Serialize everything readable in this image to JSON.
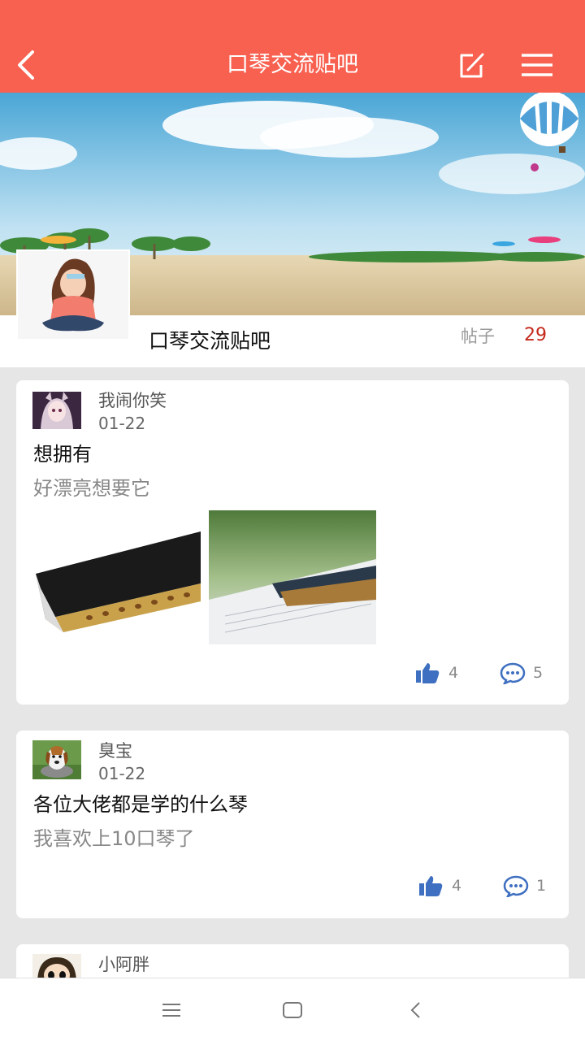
{
  "header": {
    "title": "口琴交流贴吧",
    "back_icon": "back-arrow-icon",
    "edit_icon": "edit-icon",
    "menu_icon": "menu-icon",
    "bg_color": "#f8604f"
  },
  "forum": {
    "name": "口琴交流贴吧",
    "posts_label": "帖子",
    "posts_count": "29"
  },
  "posts": [
    {
      "author": "我闹你笑",
      "date": "01-22",
      "title": "想拥有",
      "body": "好漂亮想要它",
      "likes": "4",
      "comments": "5"
    },
    {
      "author": "臭宝",
      "date": "01-22",
      "title": "各位大佬都是学的什么琴",
      "body": "我喜欢上10口琴了",
      "likes": "4",
      "comments": "1"
    },
    {
      "author": "小阿胖"
    }
  ],
  "navbar": {
    "icons": [
      "recent-apps-icon",
      "home-icon",
      "back-icon"
    ]
  }
}
